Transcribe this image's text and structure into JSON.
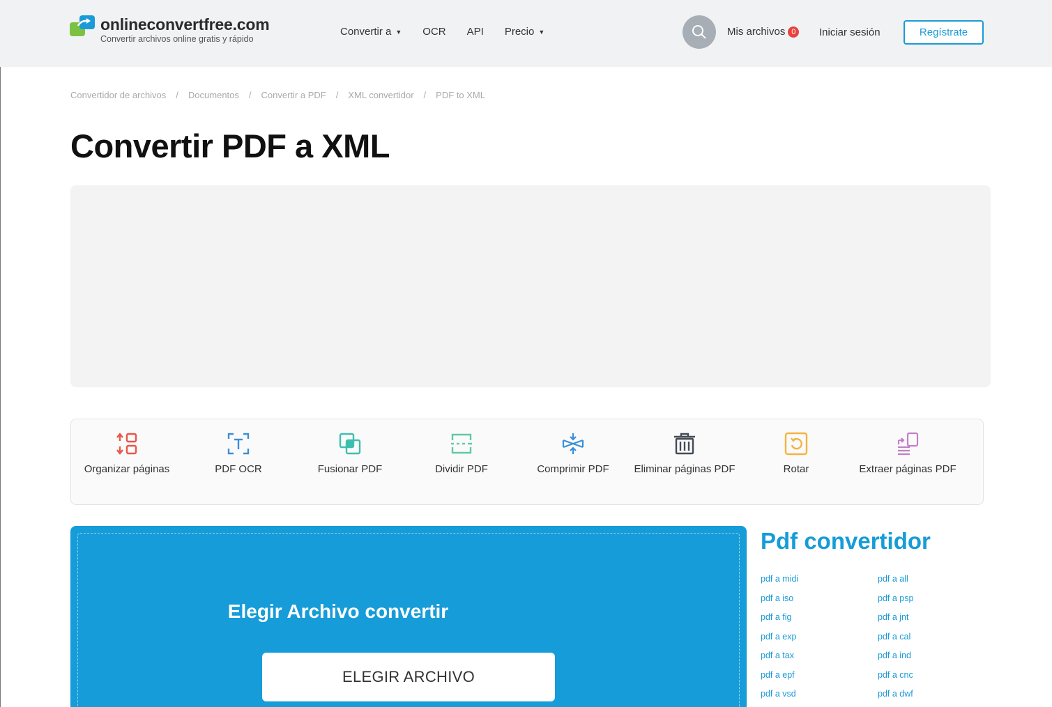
{
  "header": {
    "logo_title": "onlineconvertfree.com",
    "logo_subtitle": "Convertir archivos online gratis y rápido",
    "nav": [
      {
        "label": "Convertir a",
        "dropdown": true
      },
      {
        "label": "OCR",
        "dropdown": false
      },
      {
        "label": "API",
        "dropdown": false
      },
      {
        "label": "Precio",
        "dropdown": true
      }
    ],
    "my_files_label": "Mis archivos",
    "my_files_count": "0",
    "login_label": "Iniciar sesión",
    "register_label": "Regístrate"
  },
  "breadcrumb": [
    "Convertidor de archivos",
    "Documentos",
    "Convertir a PDF",
    "XML convertidor",
    "PDF to XML"
  ],
  "page_title": "Convertir PDF a XML",
  "tools": [
    {
      "label": "Organizar páginas",
      "icon": "organize-pages-icon",
      "color": "#e8574a"
    },
    {
      "label": "PDF OCR",
      "icon": "ocr-icon",
      "color": "#3a8fd8"
    },
    {
      "label": "Fusionar PDF",
      "icon": "merge-icon",
      "color": "#3dbfb0"
    },
    {
      "label": "Dividir PDF",
      "icon": "split-icon",
      "color": "#62c9a2"
    },
    {
      "label": "Comprimir PDF",
      "icon": "compress-icon",
      "color": "#3a8fd8"
    },
    {
      "label": "Eliminar páginas PDF",
      "icon": "trash-icon",
      "color": "#444b55"
    },
    {
      "label": "Rotar",
      "icon": "rotate-icon",
      "color": "#f3b441"
    },
    {
      "label": "Extraer páginas PDF",
      "icon": "extract-pages-icon",
      "color": "#c27ec9"
    }
  ],
  "upload": {
    "title": "Elegir Archivo convertir",
    "button_label": "ELEGIR ARCHIVO",
    "bg_color": "#169cd8"
  },
  "sidebar": {
    "title": "Pdf convertidor",
    "links_col1": [
      "pdf a midi",
      "pdf a iso",
      "pdf a fig",
      "pdf a exp",
      "pdf a tax",
      "pdf a epf",
      "pdf a vsd"
    ],
    "links_col2": [
      "pdf a all",
      "pdf a psp",
      "pdf a jnt",
      "pdf a cal",
      "pdf a ind",
      "pdf a cnc",
      "pdf a dwf"
    ]
  }
}
